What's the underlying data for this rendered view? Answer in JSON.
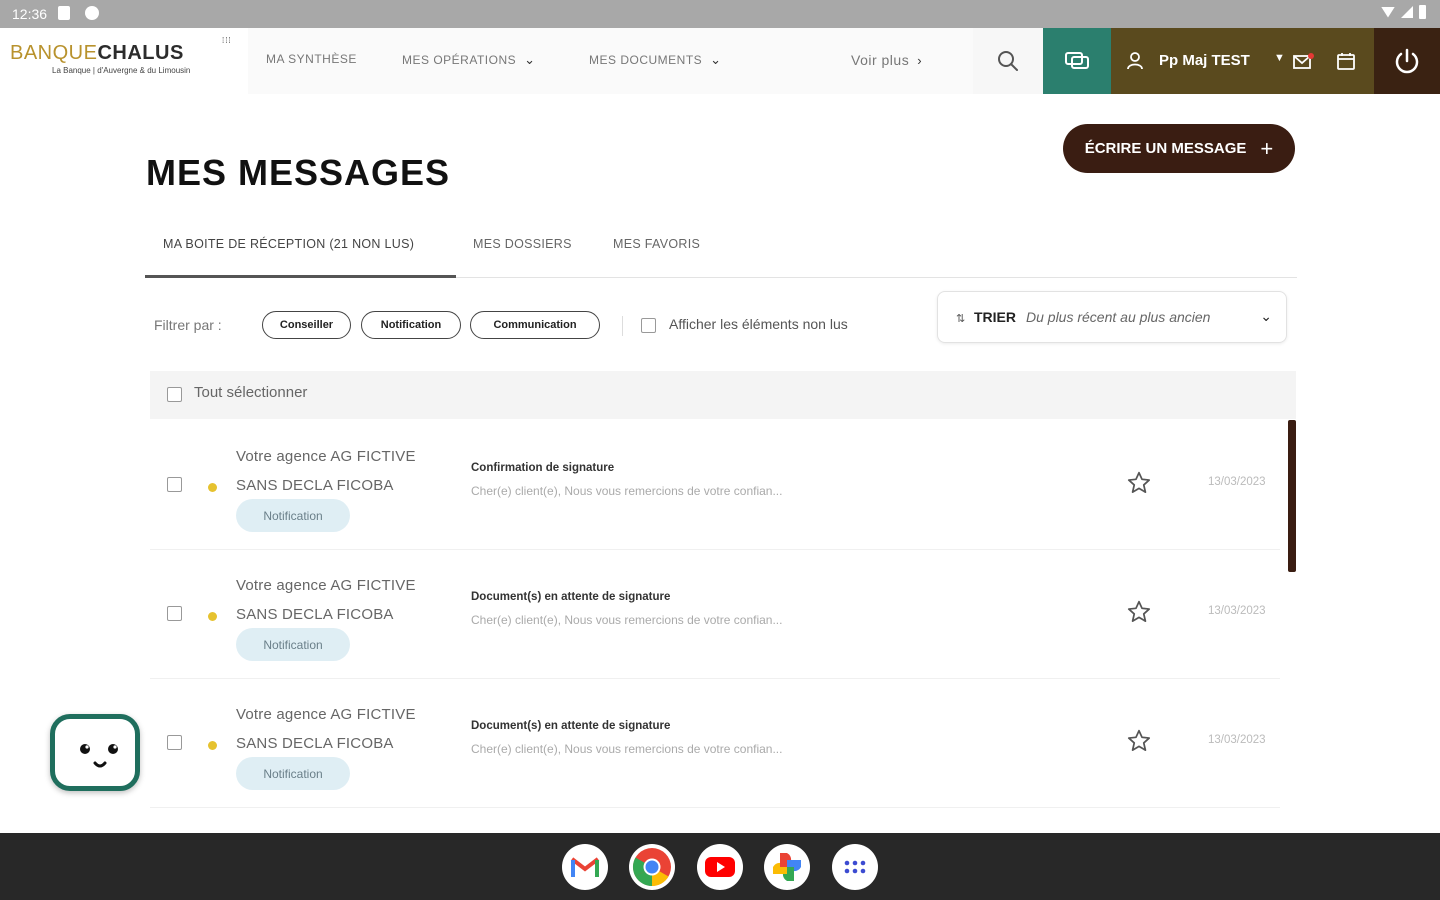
{
  "status_bar": {
    "time": "12:36"
  },
  "header": {
    "logo": {
      "banque": "BANQUE",
      "chalus": "CHALUS",
      "tagline": "La Banque | d'Auvergne & du Limousin"
    },
    "nav": [
      {
        "label": "MA SYNTHÈSE"
      },
      {
        "label": "MES OPÉRATIONS"
      },
      {
        "label": "MES DOCUMENTS"
      }
    ],
    "more_label": "Voir plus",
    "user_name": "Pp Maj TEST"
  },
  "page": {
    "title": "MES MESSAGES",
    "write_button": "ÉCRIRE UN MESSAGE"
  },
  "tabs": [
    {
      "label": "MA BOITE DE RÉCEPTION (21 NON LUS)",
      "active": true
    },
    {
      "label": "MES DOSSIERS",
      "active": false
    },
    {
      "label": "MES FAVORIS",
      "active": false
    }
  ],
  "filters": {
    "label": "Filtrer par :",
    "chips": [
      "Conseiller",
      "Notification",
      "Communication"
    ],
    "unread_label": "Afficher les éléments non lus",
    "sort_label": "TRIER",
    "sort_value": "Du plus récent au plus ancien"
  },
  "select_all_label": "Tout sélectionner",
  "messages": [
    {
      "sender_line1": "Votre agence AG FICTIVE",
      "sender_line2": "SANS DECLA FICOBA",
      "badge": "Notification",
      "subject": "Confirmation de signature",
      "preview": "Cher(e) client(e), Nous vous remercions de votre confian...",
      "date": "13/03/2023",
      "unread": true
    },
    {
      "sender_line1": "Votre agence AG FICTIVE",
      "sender_line2": "SANS DECLA FICOBA",
      "badge": "Notification",
      "subject": "Document(s) en attente de signature",
      "preview": "Cher(e) client(e), Nous vous remercions de votre confian...",
      "date": "13/03/2023",
      "unread": true
    },
    {
      "sender_line1": "Votre agence AG FICTIVE",
      "sender_line2": "SANS DECLA FICOBA",
      "badge": "Notification",
      "subject": "Document(s) en attente de signature",
      "preview": "Cher(e) client(e), Nous vous remercions de votre confian...",
      "date": "13/03/2023",
      "unread": true
    }
  ],
  "colors": {
    "accent_green": "#2b7f6e",
    "user_brown": "#5a4a1e",
    "dark_brown": "#3a1d12",
    "unread_dot": "#e6c22f",
    "badge_bg": "#dfeef4"
  },
  "taskbar_apps": [
    "gmail-icon",
    "chrome-icon",
    "youtube-icon",
    "photos-icon",
    "app-drawer-icon"
  ]
}
